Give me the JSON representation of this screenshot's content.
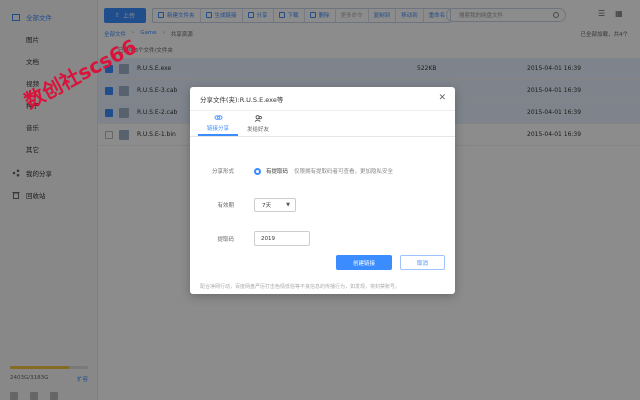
{
  "sidebar": {
    "items": [
      {
        "label": "全部文件",
        "icon": "folder-icon",
        "active": true
      },
      {
        "label": "图片"
      },
      {
        "label": "文档"
      },
      {
        "label": "视频"
      },
      {
        "label": "种子"
      },
      {
        "label": "音乐"
      },
      {
        "label": "其它"
      },
      {
        "label": "我的分享",
        "icon": "share-icon"
      },
      {
        "label": "回收站",
        "icon": "trash-icon"
      }
    ],
    "storage": {
      "text": "2403G/3183G",
      "expand": "扩容",
      "fraction": 0.755
    }
  },
  "toolbar": {
    "upload": "上传",
    "buttons": [
      "新建文件夹",
      "生成链接",
      "分享",
      "下载",
      "删除",
      "更多命令",
      "复制到",
      "移动到",
      "重命名"
    ]
  },
  "search": {
    "placeholder": "搜索我的网盘文件"
  },
  "breadcrumb": {
    "back": "全部文件",
    "path1": "Game",
    "current": "共享资源"
  },
  "loaded_text": "已全部加载，共4个",
  "selection_text": "已选中3个文件/文件夹",
  "files": [
    {
      "name": "R.U.S.E.exe",
      "size": "522KB",
      "date": "2015-04-01 16:39",
      "selected": true
    },
    {
      "name": "R.U.S.E-3.cab",
      "size": "",
      "date": "2015-04-01 16:39",
      "selected": true
    },
    {
      "name": "R.U.S.E-2.cab",
      "size": "",
      "date": "2015-04-01 16:39",
      "selected": true
    },
    {
      "name": "R.U.S.E-1.bin",
      "size": "",
      "date": "2015-04-01 16:39",
      "selected": false
    }
  ],
  "watermark": "数创社scs66",
  "dialog": {
    "title": "分享文件(夹):R.U.S.E.exe等",
    "tabs": [
      {
        "label": "链接分享"
      },
      {
        "label": "发给好友"
      }
    ],
    "share_form_label": "分享形式",
    "share_option": "有提取码",
    "share_hint": "仅限拥有提取码者可查看，更加隐私安全",
    "validity_label": "有效期",
    "validity_value": "7天",
    "code_label": "提取码",
    "code_value": "2019",
    "create_button": "创建链接",
    "cancel_button": "取消",
    "footer": "配合净网行动，百度网盘严厉打击色情低俗等不良信息的传播行为，如发现，将封禁账号。"
  },
  "colors": {
    "accent": "#3b8cff",
    "watermark": "#d9143a"
  }
}
